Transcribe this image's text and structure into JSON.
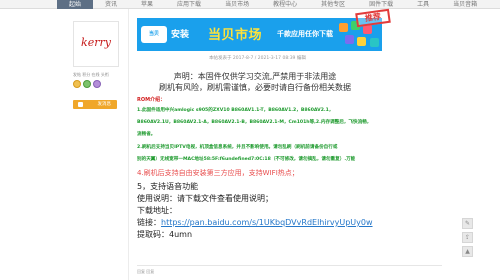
{
  "nav": {
    "items": [
      "起始",
      "资讯",
      "苹果",
      "应用下载",
      "当贝市场",
      "教程中心",
      "其他专区",
      "固件下载",
      "工具",
      "当贝音箱"
    ],
    "active_index": 0
  },
  "user": {
    "avatar_text": "kerry",
    "meta": "发帖 积分 在线 头衔",
    "message_button": "发消息"
  },
  "banner": {
    "logo": "当贝",
    "install": "安装",
    "name": "当贝市场",
    "slogan": "千款应用任你下载",
    "stamp": "推荐"
  },
  "post": {
    "date": "本帖发表于 2017-8-7 / 2021-3-17 08:39 编辑",
    "declaration": "声明：本固件仅供学习交流,严禁用于非法用途",
    "risk": "刷机有风险，刷机需谨慎，必要时请自行备份相关数据",
    "rom_title": "ROM介绍：",
    "features": [
      "1.此固件适用中兴amlogic s905的ZXV10 B860AV1.1-T，B860AV1.2，B860AV2.1，",
      "B860AV2.1U，B860AV2.1-A，B860AV2.1-B，B860AV2.1-M，Cm101h等,2.内存调整后，飞快流畅，",
      "流畅省。",
      "2.刷机后支持当贝IPTV电视，机顶盒信息系统，并且不影响使用。请勿乱刷（刷机前请备份自行或",
      "别的天翼）无线宽带一MAC地址58:5F:f6undefined7:0C:18（不可修改，请勿搞乱，请勿重复）.万能",
      "4.刷机后支持自由安装第三方应用，支持WIFI热点；"
    ],
    "voice": "5，支持语音功能",
    "usage": "使用说明：请下载文件查看使用说明；",
    "download_label": "下载地址：",
    "link_label": "链接：",
    "link_url": "https://pan.baidu.com/s/1UKbqDVvRdElhirvyUpUy0w",
    "code": "提取码：4umn",
    "reply": "回复 回复"
  },
  "side": {
    "icons": [
      "comment-icon",
      "share-icon",
      "up-icon"
    ]
  }
}
